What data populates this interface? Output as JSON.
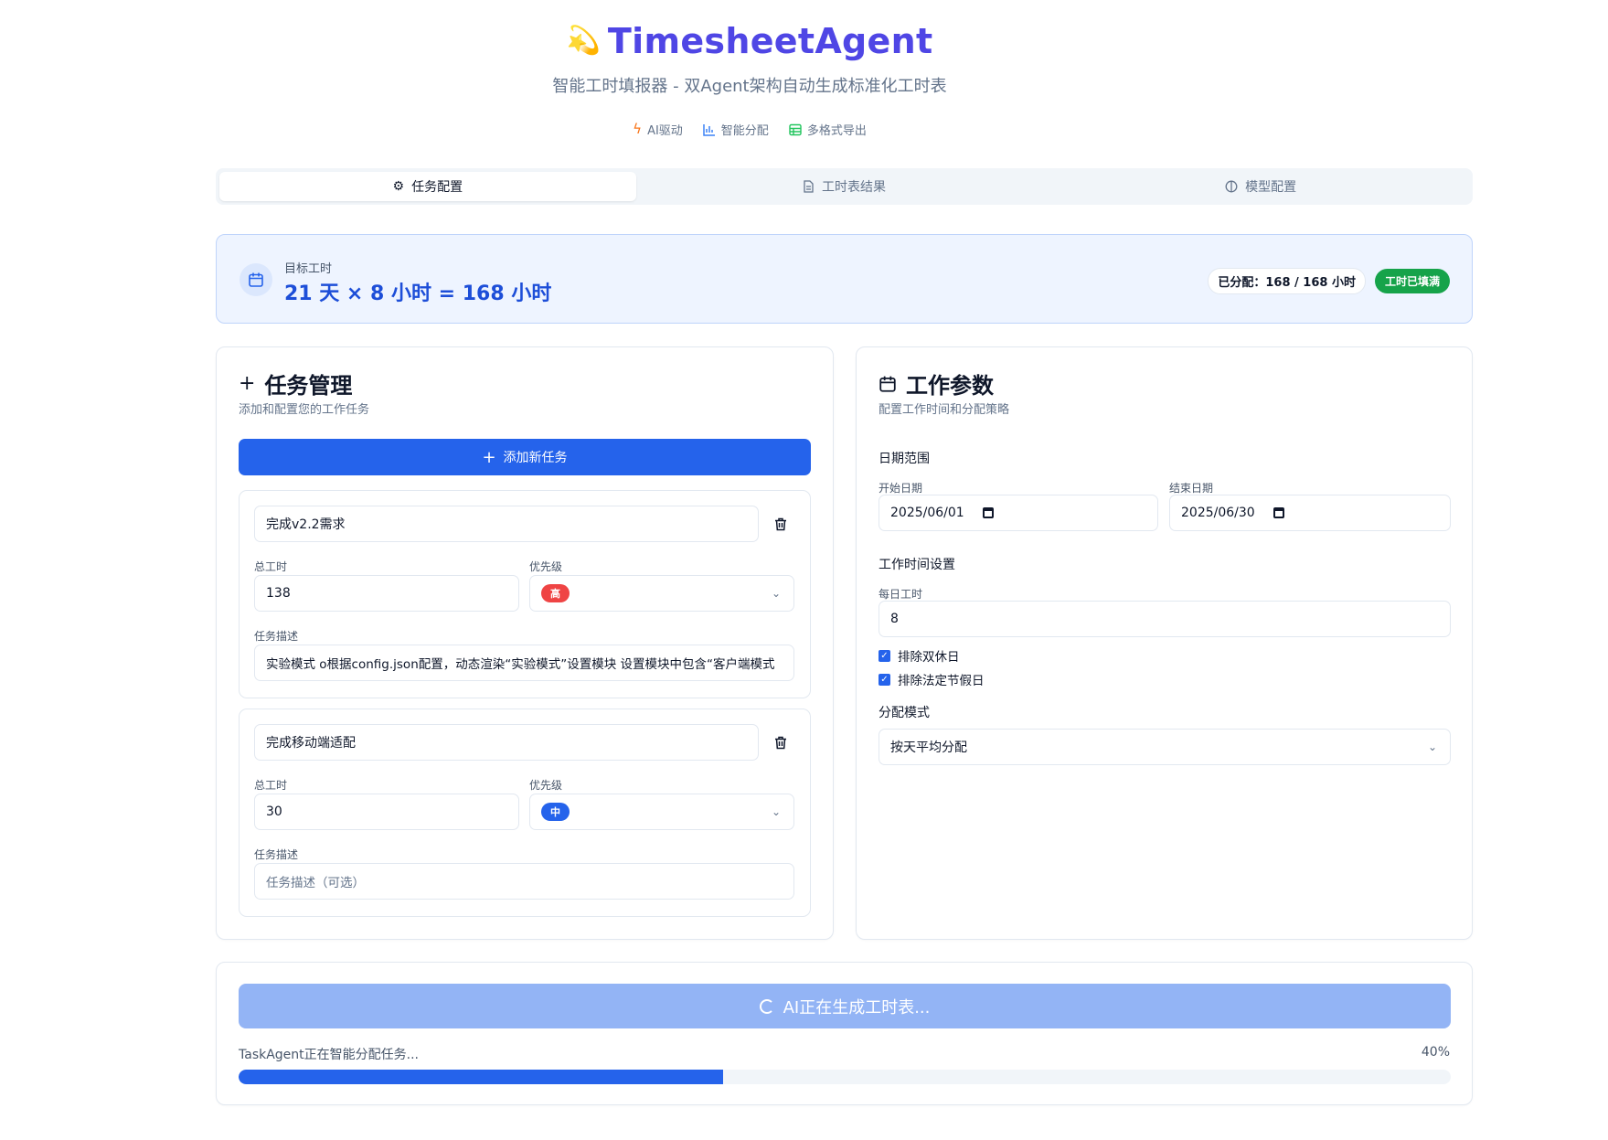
{
  "header": {
    "logo_emoji": "💫",
    "title": "TimesheetAgent",
    "subtitle": "智能工时填报器 - 双Agent架构自动生成标准化工时表",
    "features": [
      {
        "icon": "zap-icon",
        "label": "AI驱动",
        "color": "#f97316"
      },
      {
        "icon": "bar-chart-icon",
        "label": "智能分配",
        "color": "#3b82f6"
      },
      {
        "icon": "table-icon",
        "label": "多格式导出",
        "color": "#22c55e"
      }
    ]
  },
  "tabs": [
    {
      "icon": "gear-icon",
      "label": "任务配置",
      "active": true
    },
    {
      "icon": "document-icon",
      "label": "工时表结果",
      "active": false
    },
    {
      "icon": "model-icon",
      "label": "模型配置",
      "active": false
    }
  ],
  "target": {
    "label": "目标工时",
    "value": "21 天 × 8 小时 = 168 小时",
    "allocated": "已分配：168 / 168 小时",
    "status_badge": "工时已填满"
  },
  "task_panel": {
    "title": "任务管理",
    "subtitle": "添加和配置您的工作任务",
    "add_button": "添加新任务",
    "hours_label": "总工时",
    "priority_label": "优先级",
    "desc_label": "任务描述",
    "tasks": [
      {
        "name": "完成v2.2需求",
        "hours": "138",
        "priority": "高",
        "priority_color": "#ef4444",
        "description": "实验模式 o根据config.json配置，动态渲染“实验模式”设置模块 设置模块中包含“客户端模式",
        "description_placeholder": false
      },
      {
        "name": "完成移动端适配",
        "hours": "30",
        "priority": "中",
        "priority_color": "#2563eb",
        "description": "任务描述（可选）",
        "description_placeholder": true
      }
    ]
  },
  "params_panel": {
    "title": "工作参数",
    "subtitle": "配置工作时间和分配策略",
    "date_range_title": "日期范围",
    "start_label": "开始日期",
    "start_value": "2025/06/01",
    "end_label": "结束日期",
    "end_value": "2025/06/30",
    "work_time_title": "工作时间设置",
    "daily_hours_label": "每日工时",
    "daily_hours_value": "8",
    "exclude_weekends": "排除双休日",
    "exclude_holidays": "排除法定节假日",
    "mode_title": "分配模式",
    "mode_value": "按天平均分配"
  },
  "generation": {
    "button_label": "AI正在生成工时表...",
    "status": "TaskAgent正在智能分配任务...",
    "progress_percent": 40,
    "progress_label": "40%"
  }
}
